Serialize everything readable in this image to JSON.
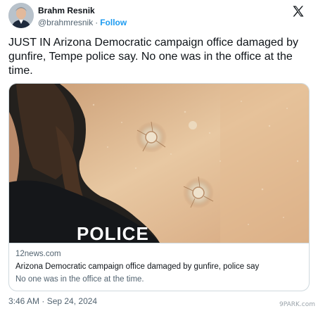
{
  "author": {
    "name": "Brahm Resnik",
    "handle": "@brahmresnik",
    "separator": "·",
    "follow_label": "Follow"
  },
  "platform_icon": "x-logo-icon",
  "tweet": {
    "text": "JUST IN Arizona Democratic campaign office damaged by gunfire, Tempe police say. No one was in the office at the time."
  },
  "media": {
    "photo_text": "POLICE",
    "domain": "12news.com",
    "title": "Arizona Democratic campaign office damaged by gunfire, police say",
    "description": "No one was in the office at the time."
  },
  "timestamp": "3:46 AM · Sep 24, 2024",
  "watermark": "9PARK.com",
  "colors": {
    "link_blue": "#1d9bf0",
    "secondary_text": "#536471",
    "border": "#cfd9de"
  }
}
